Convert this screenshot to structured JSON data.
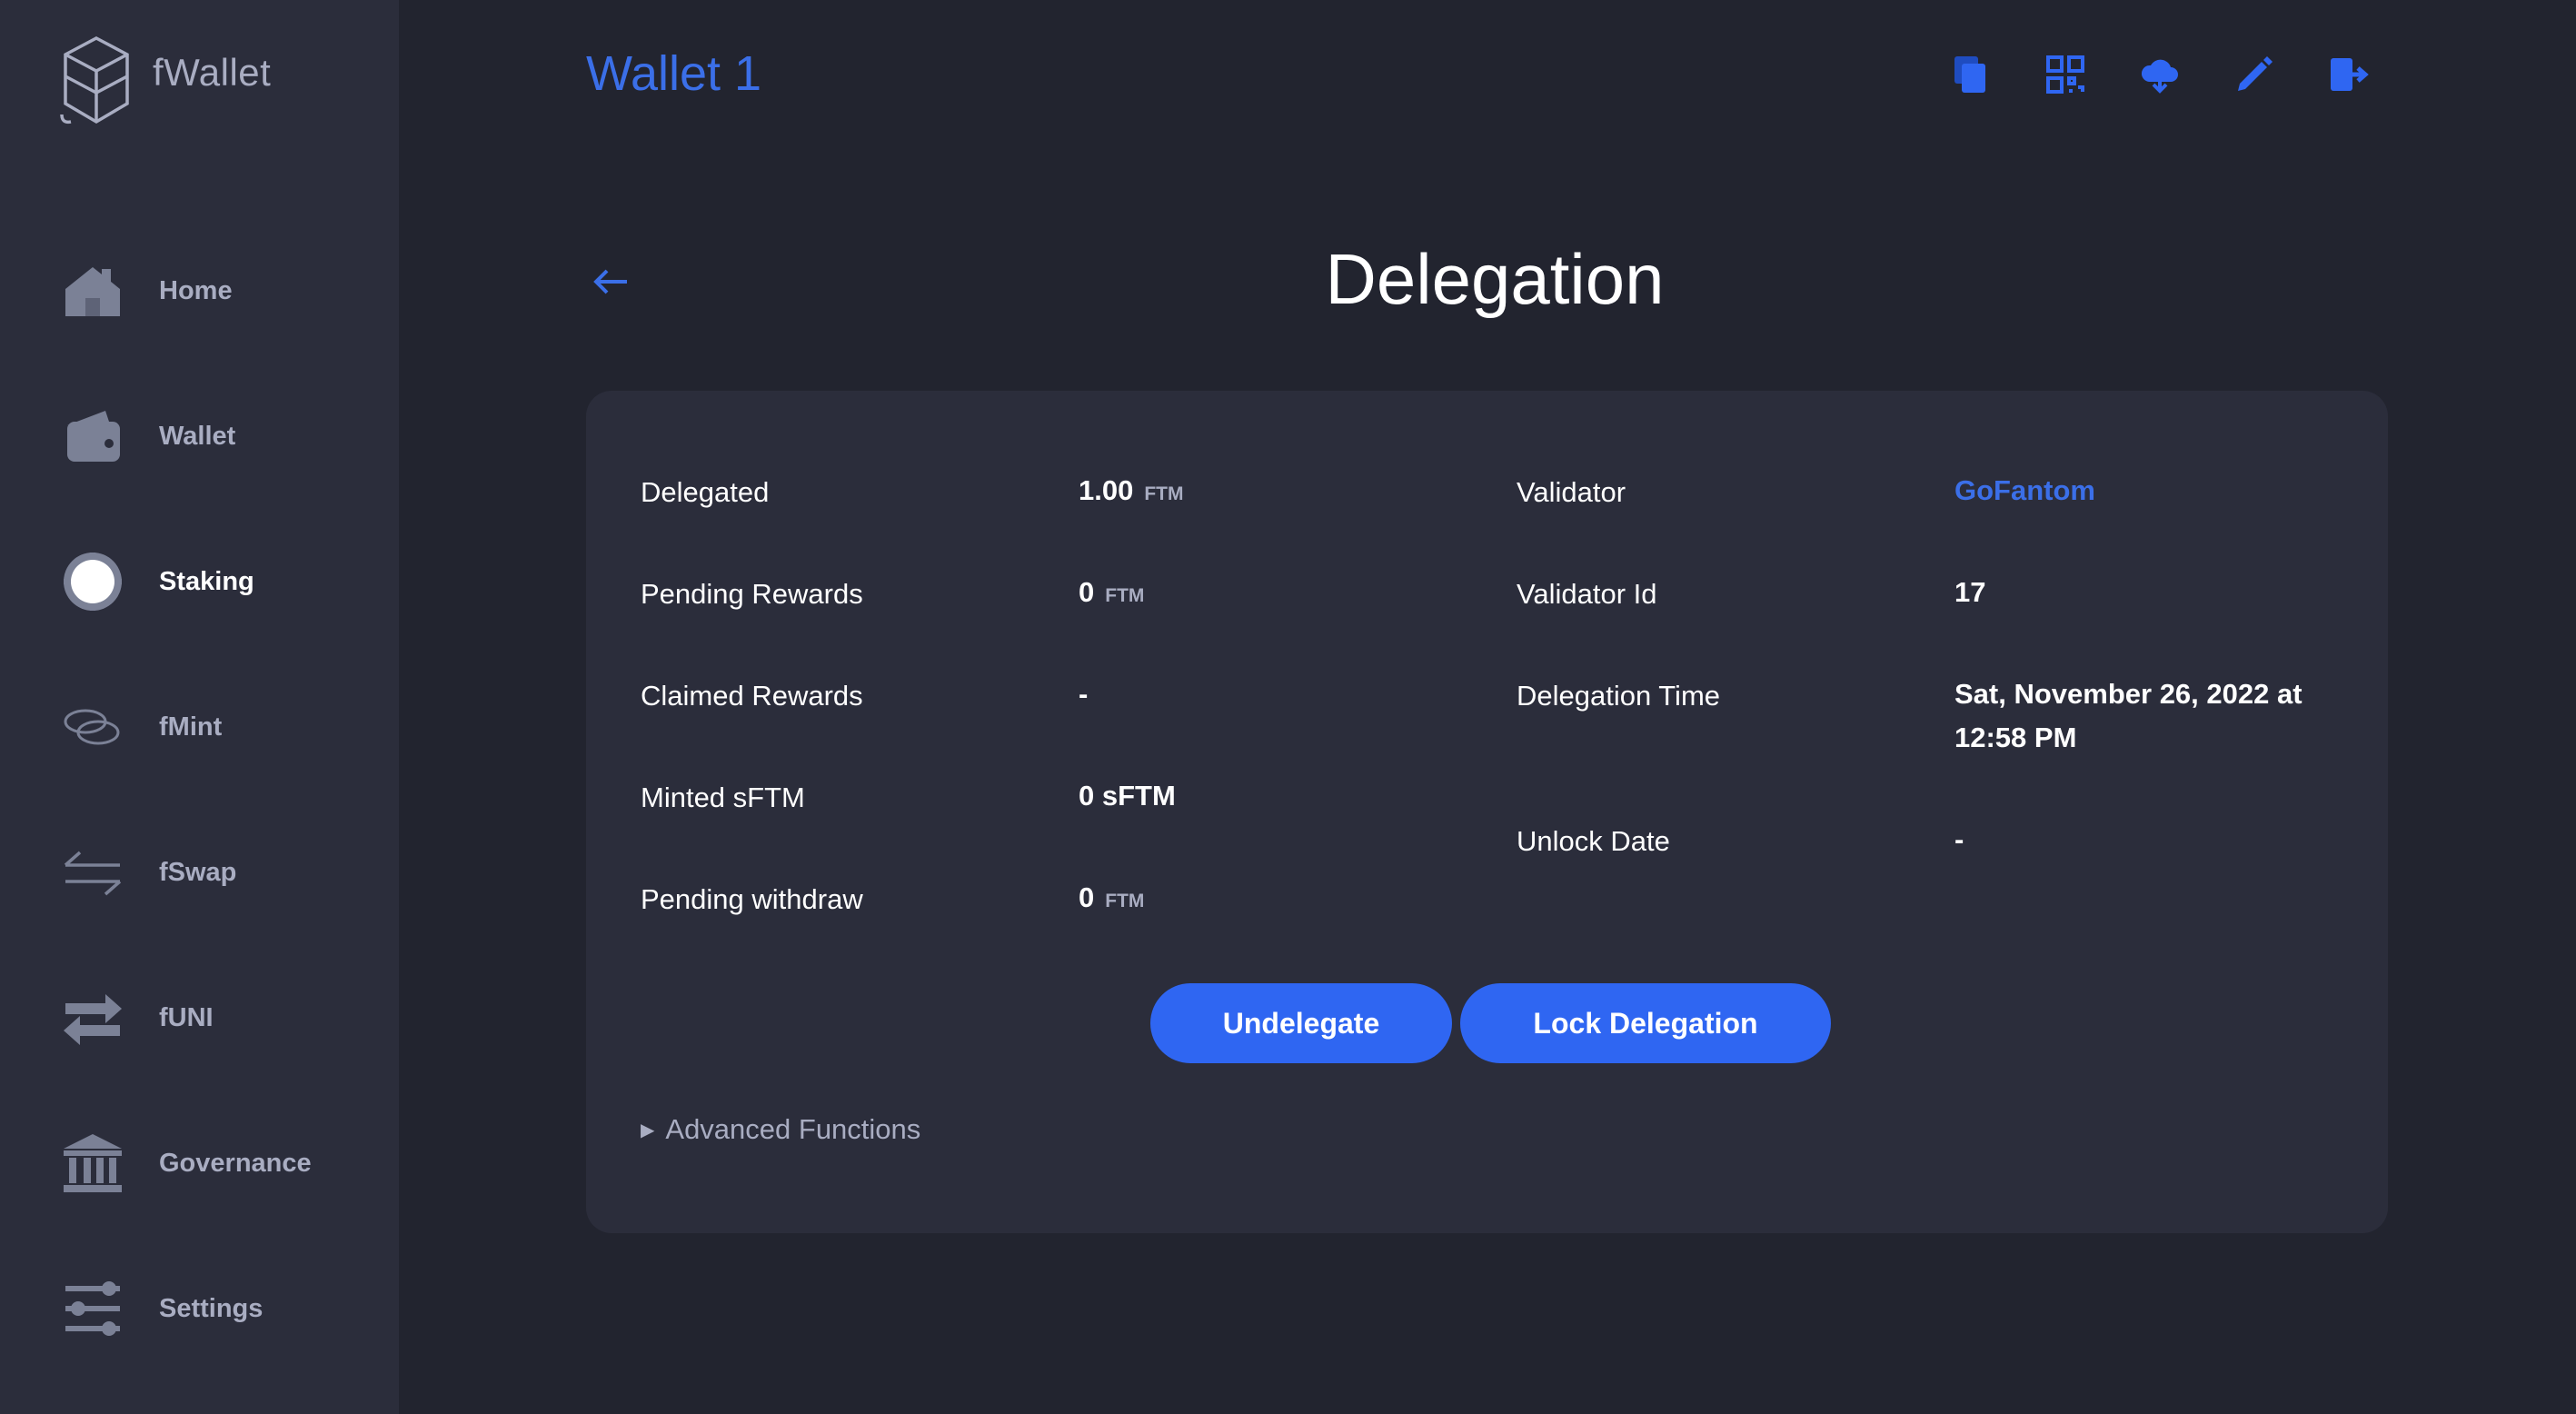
{
  "app": {
    "name": "fWallet"
  },
  "sidebar": {
    "items": [
      {
        "label": "Home",
        "icon": "home-icon"
      },
      {
        "label": "Wallet",
        "icon": "wallet-icon"
      },
      {
        "label": "Staking",
        "icon": "staking-icon",
        "active": true
      },
      {
        "label": "fMint",
        "icon": "fmint-icon"
      },
      {
        "label": "fSwap",
        "icon": "fswap-icon"
      },
      {
        "label": "fUNI",
        "icon": "funi-icon"
      },
      {
        "label": "Governance",
        "icon": "governance-icon"
      },
      {
        "label": "Settings",
        "icon": "settings-icon"
      }
    ]
  },
  "header": {
    "wallet_title": "Wallet 1",
    "icons": [
      "copy-icon",
      "qr-code-icon",
      "cloud-download-icon",
      "edit-icon",
      "logout-icon"
    ]
  },
  "page": {
    "title": "Delegation"
  },
  "delegation": {
    "left": {
      "delegated_label": "Delegated",
      "delegated_value": "1.00",
      "delegated_unit": "FTM",
      "pending_rewards_label": "Pending Rewards",
      "pending_rewards_value": "0",
      "pending_rewards_unit": "FTM",
      "claimed_rewards_label": "Claimed Rewards",
      "claimed_rewards_value": "-",
      "minted_sftm_label": "Minted sFTM",
      "minted_sftm_value": "0 sFTM",
      "pending_withdraw_label": "Pending withdraw",
      "pending_withdraw_value": "0",
      "pending_withdraw_unit": "FTM"
    },
    "right": {
      "validator_label": "Validator",
      "validator_value": "GoFantom",
      "validator_id_label": "Validator Id",
      "validator_id_value": "17",
      "delegation_time_label": "Delegation Time",
      "delegation_time_line1": "Sat, November 26, 2022 at",
      "delegation_time_line2": "12:58 PM",
      "unlock_date_label": "Unlock Date",
      "unlock_date_value": "-"
    },
    "buttons": {
      "undelegate": "Undelegate",
      "lock_delegation": "Lock Delegation"
    },
    "advanced_label": "Advanced Functions"
  },
  "colors": {
    "accent": "#2f66f2",
    "link": "#3b6fe8",
    "sidebar_bg": "#2b2d3b",
    "page_bg": "#22242f",
    "muted_text": "#a9adc2"
  }
}
